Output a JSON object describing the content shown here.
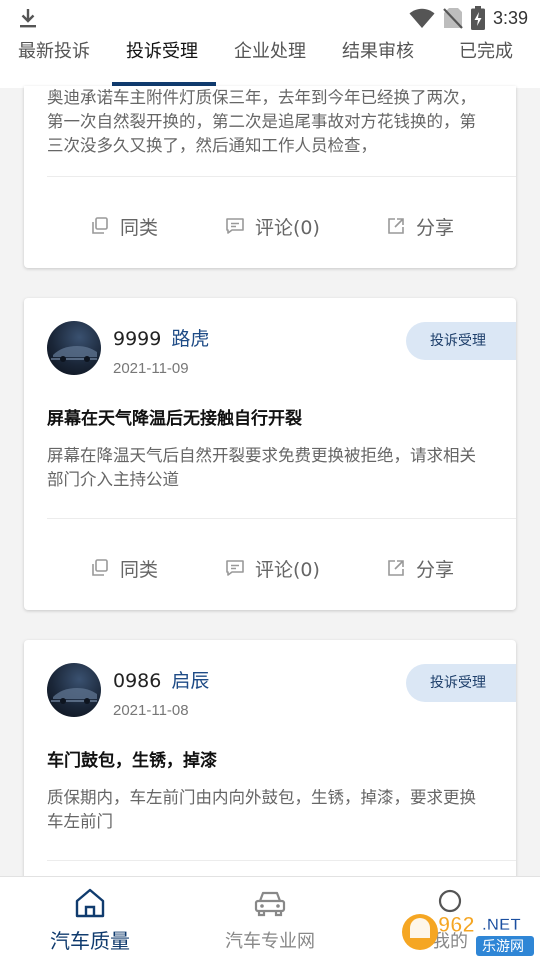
{
  "status_bar": {
    "time": "3:39",
    "icons": [
      "download-icon",
      "wifi-icon",
      "no-sim-icon",
      "battery-charging-icon"
    ]
  },
  "tabs": [
    {
      "label": "最新投诉",
      "active": false
    },
    {
      "label": "投诉受理",
      "active": true
    },
    {
      "label": "企业处理",
      "active": false
    },
    {
      "label": "结果审核",
      "active": false
    },
    {
      "label": "已完成",
      "active": false
    }
  ],
  "posts": [
    {
      "body": "奥迪承诺车主附件灯质保三年，去年到今年已经换了两次，第一次自然裂开换的，第二次是追尾事故对方花钱换的，第三次没多久又换了，然后通知工作人员检查，",
      "actions": {
        "same": "同类",
        "comment": "评论(0)",
        "share": "分享"
      }
    },
    {
      "user_id": "9999",
      "user_name": "路虎",
      "date": "2021-11-09",
      "badge": "投诉受理",
      "title": "屏幕在天气降温后无接触自行开裂",
      "body": "屏幕在降温天气后自然开裂要求免费更换被拒绝，请求相关部门介入主持公道",
      "actions": {
        "same": "同类",
        "comment": "评论(0)",
        "share": "分享"
      }
    },
    {
      "user_id": "0986",
      "user_name": "启辰",
      "date": "2021-11-08",
      "badge": "投诉受理",
      "title": "车门鼓包，生锈，掉漆",
      "body": "质保期内，车左前门由内向外鼓包，生锈，掉漆，要求更换车左前门"
    }
  ],
  "bottom_nav": [
    {
      "label": "汽车质量",
      "icon": "home-icon",
      "active": true
    },
    {
      "label": "汽车专业网",
      "icon": "car-icon",
      "active": false
    },
    {
      "label": "我的",
      "icon": "profile-icon",
      "active": false
    }
  ],
  "watermark": {
    "text": "962.NET",
    "subtext": "乐游网"
  },
  "colors": {
    "accent": "#103b6e",
    "user_name": "#1e4b86",
    "badge_bg": "#dbe7f5"
  }
}
